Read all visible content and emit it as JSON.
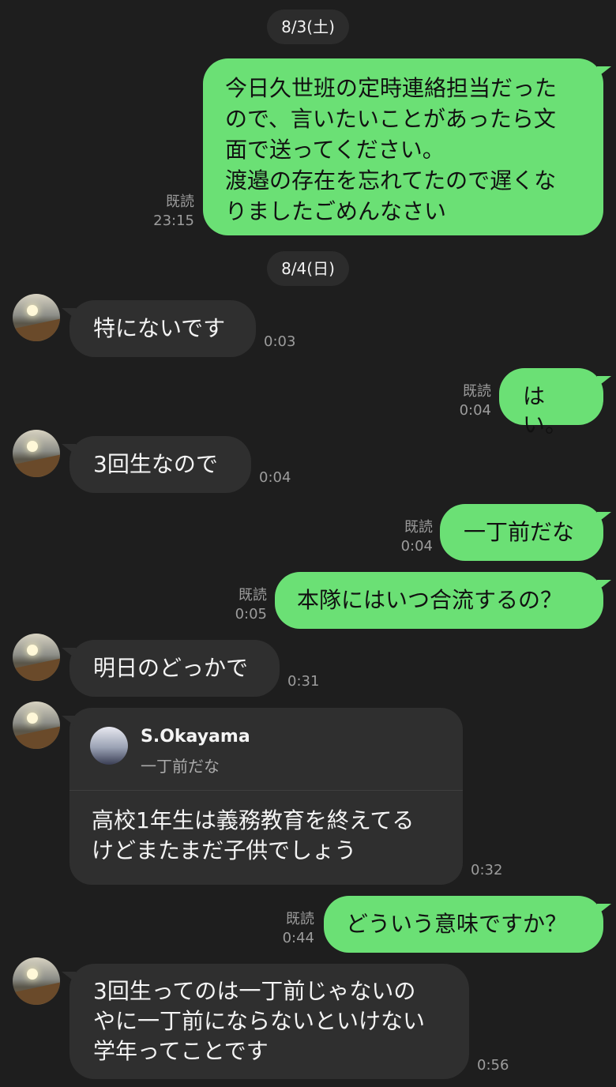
{
  "dates": [
    "8/3(土)",
    "8/4(日)"
  ],
  "read_label": "既読",
  "messages": [
    {
      "from": "me",
      "lines": [
        "今日久世班の定時連絡担当だった",
        "ので、言いたいことがあったら文",
        "面で送ってください。",
        "渡邉の存在を忘れてたので遅くな",
        "りましたごめんなさい"
      ],
      "time": "23:15"
    },
    {
      "from": "other",
      "text": "特にないです",
      "time": "0:03"
    },
    {
      "from": "me",
      "text": "はい。",
      "time": "0:04"
    },
    {
      "from": "other",
      "text": "3回生なので",
      "time": "0:04"
    },
    {
      "from": "me",
      "text": "一丁前だな",
      "time": "0:04"
    },
    {
      "from": "me",
      "text": "本隊にはいつ合流するの？",
      "time": "0:05"
    },
    {
      "from": "other",
      "text": "明日のどっかで",
      "time": "0:31"
    },
    {
      "from": "other",
      "reply_to": {
        "name": "S.Okayama",
        "text": "一丁前だな"
      },
      "lines": [
        "高校1年生は義務教育を終えてる",
        "けどまたまだ子供でしょう"
      ],
      "time": "0:32"
    },
    {
      "from": "me",
      "text": "どういう意味ですか？",
      "time": "0:44"
    },
    {
      "from": "other",
      "lines": [
        "3回生ってのは一丁前じゃないの",
        "やに一丁前にならないといけない",
        "学年ってことです"
      ],
      "time": "0:56"
    }
  ]
}
